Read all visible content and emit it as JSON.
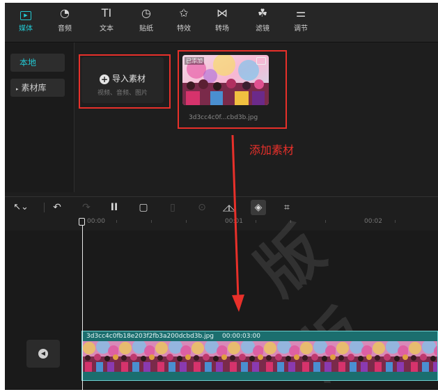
{
  "toolbar": {
    "tabs": [
      {
        "label": "媒体",
        "icon": "media-icon",
        "glyph": "▸"
      },
      {
        "label": "音频",
        "icon": "audio-icon",
        "glyph": "◔"
      },
      {
        "label": "文本",
        "icon": "text-icon",
        "glyph": "TI"
      },
      {
        "label": "贴纸",
        "icon": "sticker-icon",
        "glyph": "◷"
      },
      {
        "label": "特效",
        "icon": "effects-icon",
        "glyph": "✩"
      },
      {
        "label": "转场",
        "icon": "transition-icon",
        "glyph": "⋈"
      },
      {
        "label": "滤镜",
        "icon": "filter-icon",
        "glyph": "☘"
      },
      {
        "label": "调节",
        "icon": "adjust-icon",
        "glyph": "⚌"
      }
    ],
    "active_color": "#23c8d2"
  },
  "sidebar": {
    "local": "本地",
    "library": "素材库"
  },
  "media": {
    "import_label": "导入素材",
    "import_sub": "视频、音频、图片",
    "thumb_badge": "已添加",
    "thumb_name": "3d3cc4c0f...cbd3b.jpg"
  },
  "annotation": {
    "text": "添加素材",
    "color": "#e8302a"
  },
  "timeline": {
    "tools": [
      {
        "icon": "select-cursor-icon",
        "glyph": "↖⌄"
      },
      {
        "icon": "undo-icon",
        "glyph": "↶"
      },
      {
        "icon": "redo-icon",
        "glyph": "↷"
      },
      {
        "icon": "split-icon",
        "glyph": "]["
      },
      {
        "icon": "delete-icon",
        "glyph": "🗑"
      },
      {
        "icon": "freeze-icon",
        "glyph": "▯"
      },
      {
        "icon": "reverse-icon",
        "glyph": "⊙"
      },
      {
        "icon": "mirror-icon",
        "glyph": "◿◺"
      },
      {
        "icon": "rotate-icon",
        "glyph": "◈"
      },
      {
        "icon": "crop-icon",
        "glyph": "⌗"
      }
    ],
    "ruler_labels": [
      "00:00",
      "00:01",
      "00:02"
    ],
    "clip_name": "3d3cc4c0fb18e203f2fb3a200dcbd3b.jpg",
    "clip_duration": "00:00:03:00"
  }
}
